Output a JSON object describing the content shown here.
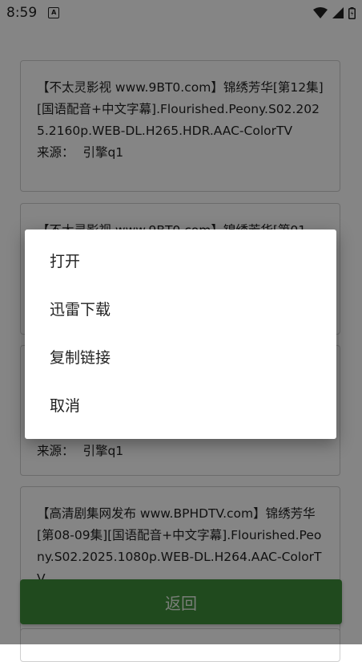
{
  "status_bar": {
    "time": "8:59",
    "notif_glyph": "A",
    "icons": [
      "wifi-icon",
      "signal-icon",
      "battery-icon"
    ]
  },
  "list": {
    "items": [
      {
        "title": "【不太灵影视 www.9BT0.com】锦绣芳华[第12集][国语配音+中文字幕].Flourished.Peony.S02.2025.2160p.WEB-DL.H265.HDR.AAC-ColorTV",
        "source_label": "来源：",
        "source": "引擎q1"
      },
      {
        "title": "【不太灵影视 www.9BT0.com】锦绣芳华[第01",
        "source_label": "",
        "source": ""
      },
      {
        "title": "",
        "source_label": "来源：",
        "source": "引擎q1"
      },
      {
        "title": "【高清剧集网发布 www.BPHDTV.com】锦绣芳华[第08-09集][国语配音+中文字幕].Flourished.Peony.S02.2025.1080p.WEB-DL.H264.AAC-ColorTV",
        "source_label": "",
        "source": ""
      }
    ]
  },
  "back_button_label": "返回",
  "dialog": {
    "options": [
      "打开",
      "迅雷下载",
      "复制链接",
      "取消"
    ]
  },
  "colors": {
    "button_green": "#3f8f3b",
    "scrim": "rgba(0,0,0,0.48)"
  }
}
